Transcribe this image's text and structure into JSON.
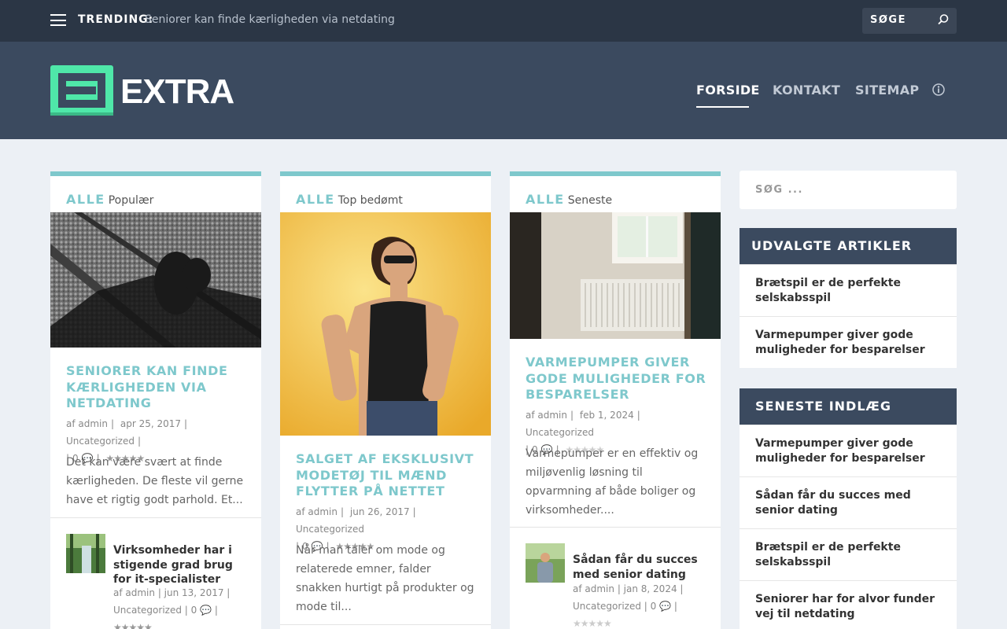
{
  "topbar": {
    "trending_label": "TRENDING:",
    "trending_text": "Seniorer kan finde kærligheden via netdating",
    "search_label": "SØGE"
  },
  "header": {
    "logo_text": "EXTRA",
    "nav": [
      "FORSIDE",
      "KONTAKT",
      "SITEMAP"
    ]
  },
  "cards": [
    {
      "tab_all": "ALLE",
      "tab_name": "Populær",
      "title": "SENIORER KAN FINDE KÆRLIGHEDEN VIA NETDATING",
      "author": "af admin",
      "date": "apr 25, 2017",
      "category": "Uncategorized",
      "comments": "0",
      "rating": 4.5,
      "excerpt": "Det kan være svært at finde kærligheden. De fleste vil gerne have et rigtig godt parhold. Et...",
      "related": {
        "title": "Virksomheder har i stigende grad brug for it-specialister",
        "author": "af admin",
        "date": "jun 13, 2017",
        "category": "Uncategorized",
        "comments": "0",
        "rating": 4
      }
    },
    {
      "tab_all": "ALLE",
      "tab_name": "Top bedømt",
      "title": "SALGET AF EKSKLUSIVT MODETØJ TIL MÆND FLYTTER PÅ NETTET",
      "author": "af admin",
      "date": "jun 26, 2017",
      "category": "Uncategorized",
      "comments": "0",
      "rating": 5,
      "excerpt": "Når man taler om mode og relaterede emner, falder snakken hurtigt på produkter og mode til..."
    },
    {
      "tab_all": "ALLE",
      "tab_name": "Seneste",
      "title": "VARMEPUMPER GIVER GODE MULIGHEDER FOR BESPARELSER",
      "author": "af admin",
      "date": "feb 1, 2024",
      "category": "Uncategorized",
      "comments": "0",
      "rating": 0,
      "excerpt": "Varmepumper er en effektiv og miljøvenlig løsning til opvarmning af både boliger og virksomheder....",
      "related": {
        "title": "Sådan får du succes med senior dating",
        "author": "af admin",
        "date": "jan 8, 2024",
        "category": "Uncategorized",
        "comments": "0",
        "rating": 0
      }
    }
  ],
  "sidebar": {
    "search_placeholder": "SØG ...",
    "featured": {
      "heading": "UDVALGTE ARTIKLER",
      "items": [
        "Brætspil er de perfekte selskabsspil",
        "Varmepumper giver gode muligheder for besparelser"
      ]
    },
    "recent": {
      "heading": "SENESTE INDLÆG",
      "items": [
        "Varmepumper giver gode muligheder for besparelser",
        "Sådan får du succes med senior dating",
        "Brætspil er de perfekte selskabsspil",
        "Seniorer har for alvor funder vej til netdating"
      ]
    }
  },
  "colors": {
    "accent": "#7ec8cc",
    "logo_green": "#4fe7a9",
    "topbar": "#2b3645",
    "header": "#3b4a5f"
  }
}
